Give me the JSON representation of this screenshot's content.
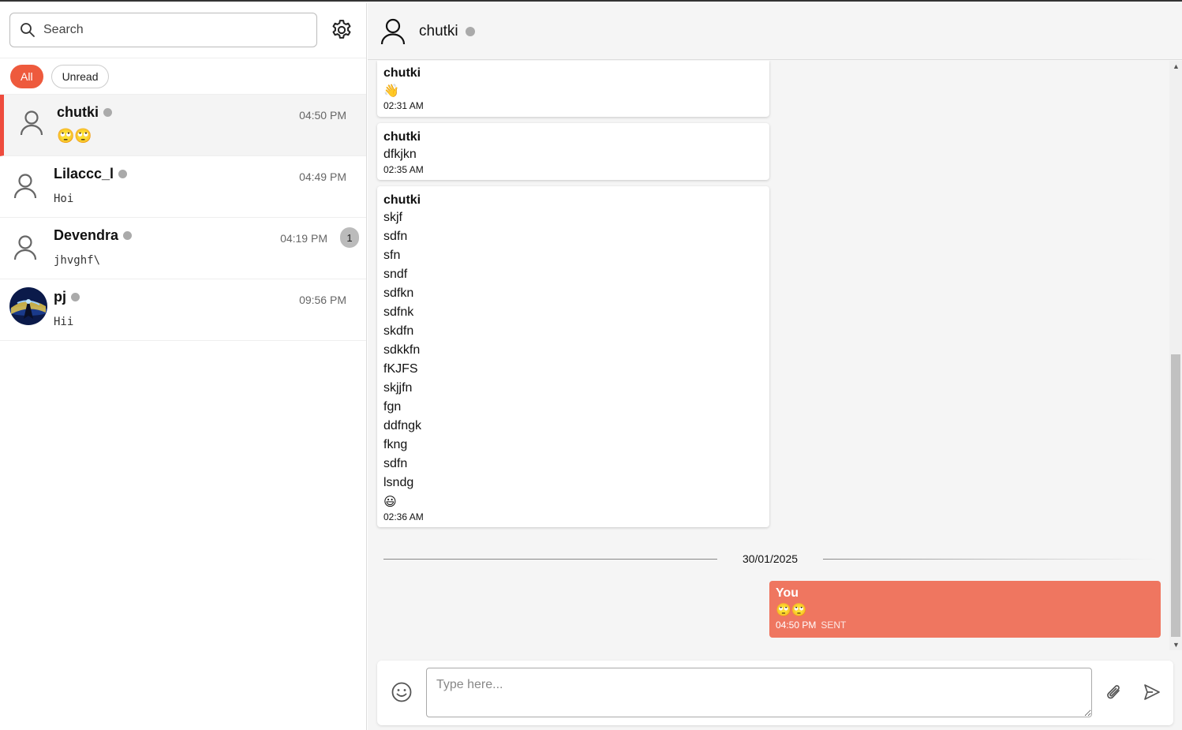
{
  "search": {
    "placeholder": "Search"
  },
  "filters": {
    "all": "All",
    "unread": "Unread"
  },
  "conversations": [
    {
      "name": "chutki",
      "time": "04:50 PM",
      "preview": "🙄🙄"
    },
    {
      "name": "Lilaccc_l",
      "time": "04:49 PM",
      "preview": "Hoi"
    },
    {
      "name": "Devendra",
      "time": "04:19 PM",
      "preview": "jhvghf\\",
      "unread": "1"
    },
    {
      "name": "pj",
      "time": "09:56 PM",
      "preview": "Hii"
    }
  ],
  "chat": {
    "title": "chutki",
    "messages": [
      {
        "sender": "chutki",
        "lines": [
          "👋"
        ],
        "time": "02:31 AM"
      },
      {
        "sender": "chutki",
        "lines": [
          "dfkjkn"
        ],
        "time": "02:35 AM"
      },
      {
        "sender": "chutki",
        "lines": [
          "skjf",
          "sdfn",
          "sfn",
          "sndf",
          "sdfkn",
          "sdfnk",
          "skdfn",
          "sdkkfn",
          "fKJFS",
          "skjjfn",
          "fgn",
          "ddfngk",
          "fkng",
          "sdfn",
          "lsndg",
          "😃"
        ],
        "time": "02:36 AM"
      }
    ],
    "date_separator": "30/01/2025",
    "outgoing": {
      "sender": "You",
      "text": "🙄🙄",
      "time": "04:50 PM",
      "status": "SENT"
    }
  },
  "composer": {
    "placeholder": "Type here..."
  },
  "colors": {
    "accent": "#ee5a3d",
    "outgoing_bubble": "#ef7660",
    "selected_border": "#ee4b3d"
  }
}
